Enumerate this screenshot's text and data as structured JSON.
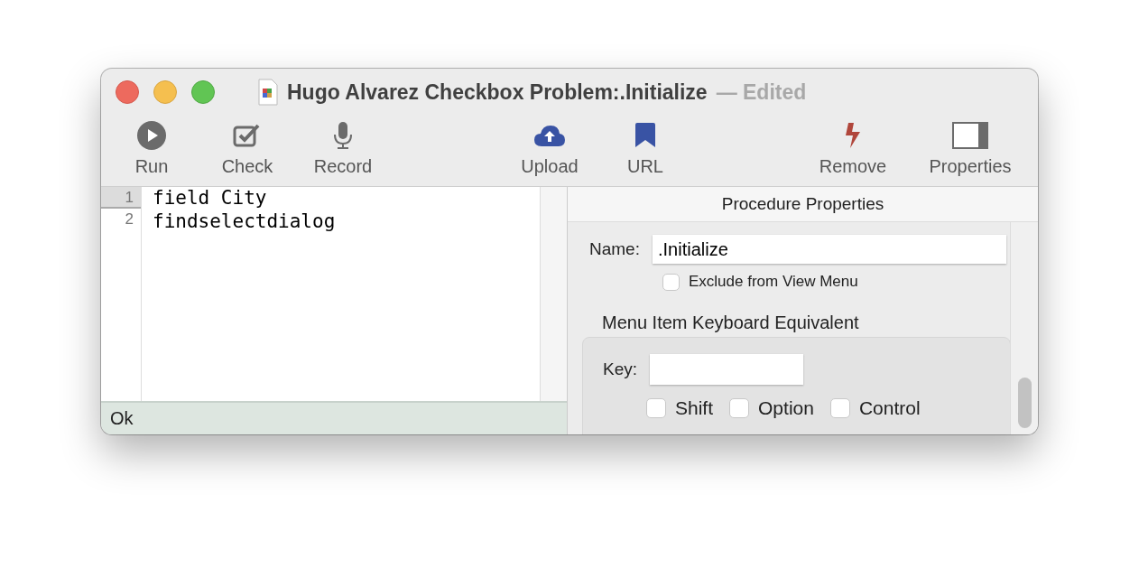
{
  "window": {
    "title": "Hugo Alvarez Checkbox Problem:.Initialize",
    "edited": "— Edited"
  },
  "toolbar": {
    "groups": [
      [
        {
          "label": "Run"
        },
        {
          "label": "Check"
        },
        {
          "label": "Record"
        }
      ],
      [
        {
          "label": "Upload"
        },
        {
          "label": "URL"
        }
      ],
      [
        {
          "label": "Remove"
        },
        {
          "label": "Properties"
        }
      ]
    ]
  },
  "editor": {
    "lines": [
      {
        "number": "1",
        "text": "field City",
        "selected": true
      },
      {
        "number": "2",
        "text": "findselectdialog",
        "selected": false
      }
    ]
  },
  "status_bar": "Ok",
  "properties": {
    "title": "Procedure Properties",
    "name_label": "Name:",
    "name_value": ".Initialize",
    "exclude": {
      "label": "Exclude from View Menu",
      "checked": false
    },
    "group_title": "Menu Item Keyboard Equivalent",
    "key_label": "Key:",
    "modifiers": [
      {
        "label": "Shift",
        "checked": false
      },
      {
        "label": "Option",
        "checked": false
      },
      {
        "label": "Control",
        "checked": false
      }
    ]
  }
}
